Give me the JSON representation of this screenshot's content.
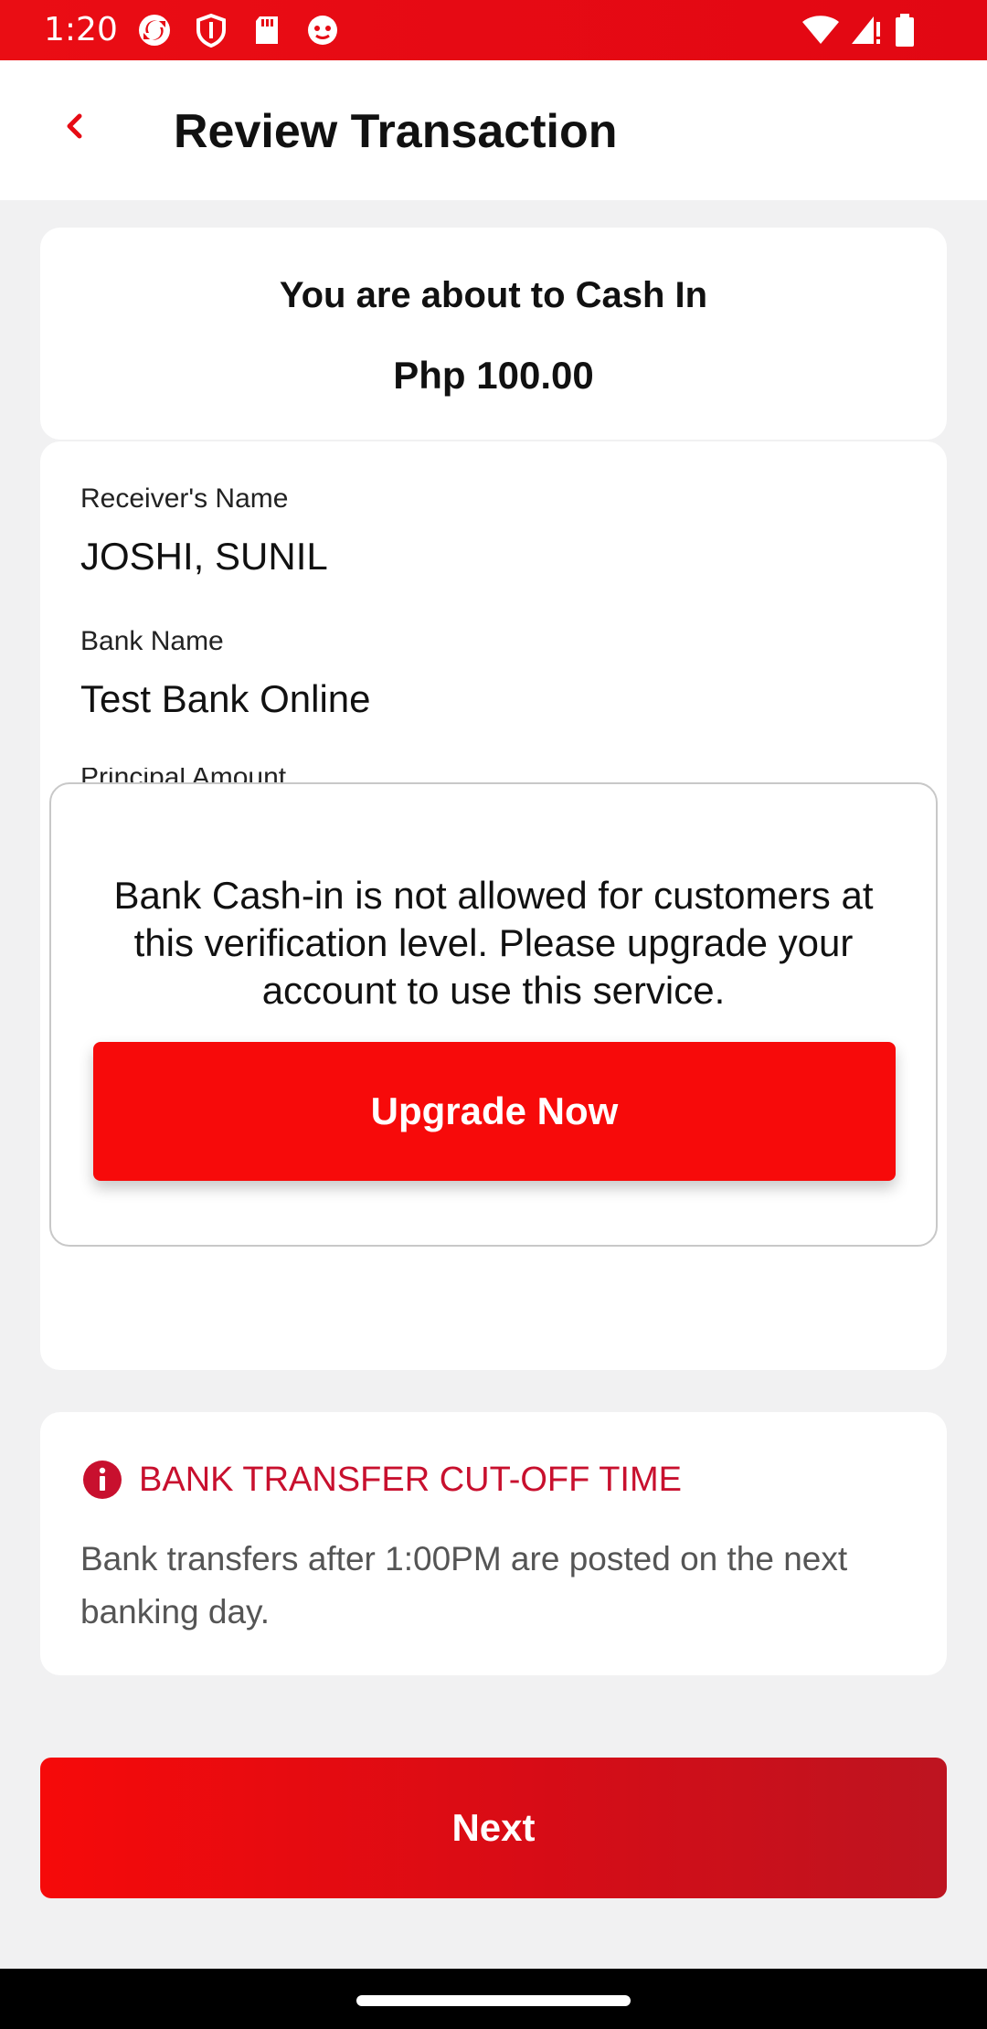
{
  "status_bar": {
    "time": "1:20",
    "notification_icons": [
      "sync-icon",
      "shield-icon",
      "sd-card-icon",
      "app-icon"
    ],
    "system_icons": [
      "wifi-icon",
      "signal-icon",
      "battery-icon"
    ]
  },
  "header": {
    "title": "Review Transaction",
    "back_icon": "chevron-left-icon"
  },
  "summary": {
    "title": "You are about to Cash In",
    "amount": "Php 100.00"
  },
  "details": {
    "fields": [
      {
        "label": "Receiver's Name",
        "value": "JOSHI, SUNIL"
      },
      {
        "label": "Bank Name",
        "value": "Test Bank Online"
      },
      {
        "label": "Principal Amount"
      }
    ]
  },
  "modal": {
    "message": "Bank Cash-in is not allowed for customers at this verification level. Please upgrade your account to use this service.",
    "button_label": "Upgrade Now"
  },
  "notice": {
    "icon": "info-icon",
    "title": "BANK TRANSFER CUT-OFF TIME",
    "body": "Bank transfers after 1:00PM are posted on the next banking day."
  },
  "footer": {
    "next_label": "Next"
  },
  "colors": {
    "brand_red": "#f70a0a",
    "status_bar": "#e60b14",
    "notice_title": "#c8102e"
  }
}
